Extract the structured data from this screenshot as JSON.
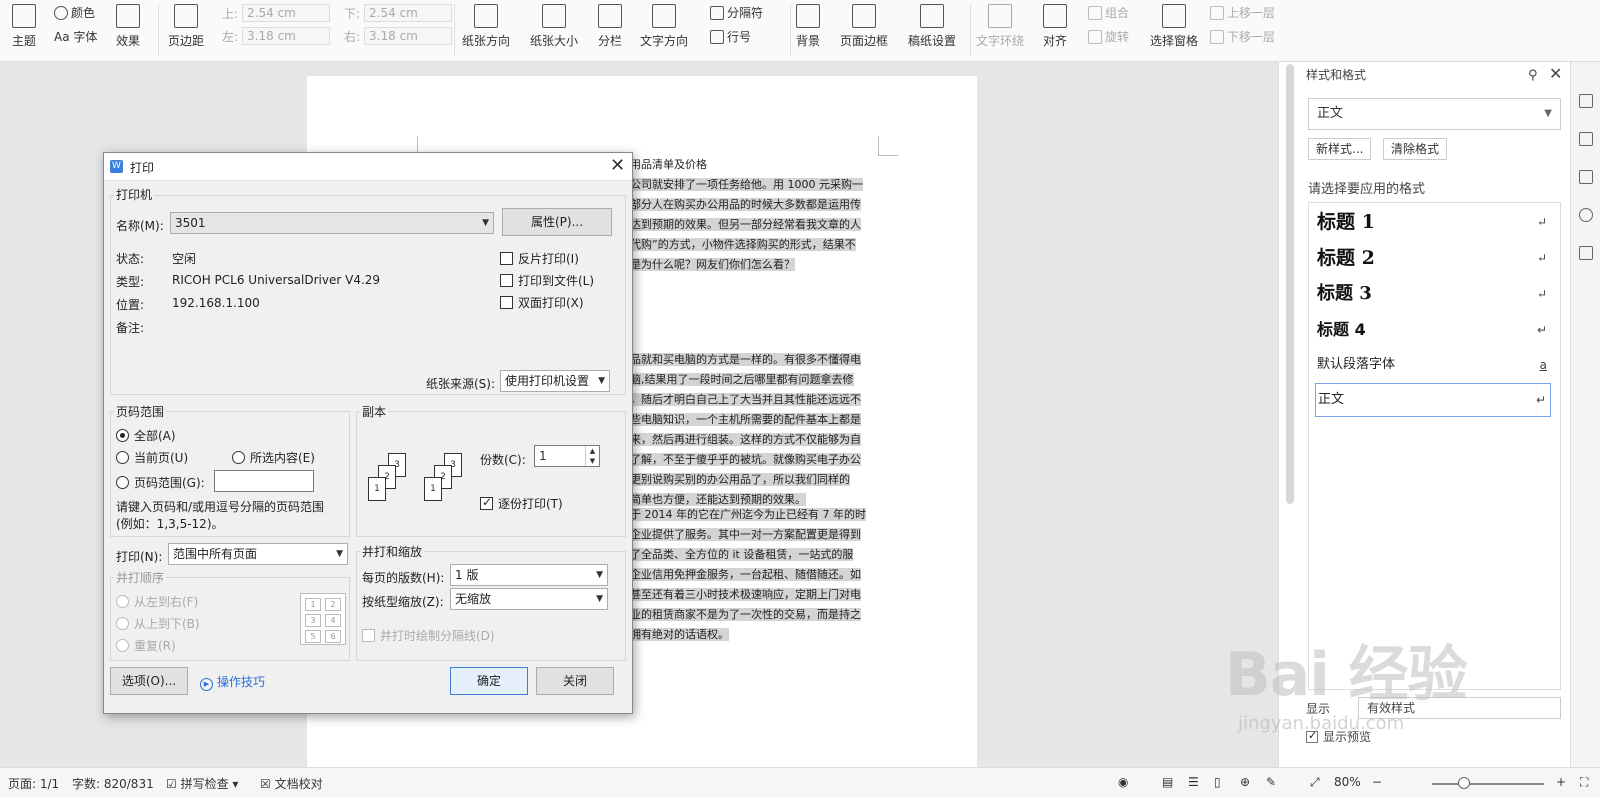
{
  "ribbon": {
    "theme": "主题",
    "color": "颜色",
    "font": "Aa 字体",
    "effect": "效果",
    "margin": "页边距",
    "margin_top_label": "上:",
    "margin_top": "2.54 cm",
    "margin_bottom_label": "下:",
    "margin_bottom": "2.54 cm",
    "margin_left_label": "左:",
    "margin_left": "3.18 cm",
    "margin_right_label": "右:",
    "margin_right": "3.18 cm",
    "orientation": "纸张方向",
    "size": "纸张大小",
    "columns": "分栏",
    "text_direction": "文字方向",
    "separator": "分隔符",
    "line_number": "行号",
    "background": "背景",
    "page_border": "页面边框",
    "manuscript": "稿纸设置",
    "text_wrap": "文字环绕",
    "align": "对齐",
    "group": "组合",
    "rotate": "旋转",
    "selection_pane": "选择窗格",
    "bring_forward": "上移一层",
    "send_backward": "下移一层"
  },
  "document": {
    "title": "用品清单及价格",
    "p1": [
      "公司就安排了一项任务给他。用 1000 元采购一",
      "部分人在购买办公用品的时候大多数都是运用传",
      "达到预期的效果。但另一部分经常看我文章的人",
      "代购”的方式，小物件选择购买的形式，结果不",
      "是为什么呢？网友们你们怎么看？"
    ],
    "p2": [
      "品就和买电脑的方式是一样的。有很多不懂得电",
      "脑,结果用了一段时间之后哪里都有问题拿去修",
      "，随后才明白自己上了大当并且其性能还远远不",
      "些电脑知识，一个主机所需要的配件基本上都是",
      "来，然后再进行组装。这样的方式不仅能够为自",
      "了解，不至于傻乎乎的被坑。就像购买电子办公",
      "更别说购买别的办公用品了，所以我们同样的",
      "简单也方便，还能达到预期的效果。"
    ],
    "p3": [
      "于 2014 年的它在广州迄今为止已经有 7 年的时",
      "企业提供了服务。其中一对一方案配置更是得到",
      "了全品类、全方位的 it 设备租赁，一站式的服",
      "企业信用免押金服务，一台起租、随借随还。如",
      "甚至还有着三小时技术极速响应，定期上门对电",
      "业的租赁商家不是为了一次性的交易，而是持之",
      "拥有绝对的话语权。"
    ]
  },
  "styles_panel": {
    "title": "样式和格式",
    "current_style": "正文",
    "new_style": "新样式...",
    "clear_format": "清除格式",
    "apply_label": "请选择要应用的格式",
    "items": [
      {
        "name": "标题 1"
      },
      {
        "name": "标题 2"
      },
      {
        "name": "标题 3"
      },
      {
        "name": "标题 4"
      },
      {
        "name": "默认段落字体"
      },
      {
        "name": "正文"
      }
    ],
    "return_mark": "↵",
    "char_mark": "a",
    "show_label": "显示",
    "show_value": "有效样式",
    "show_preview": "显示预览"
  },
  "watermark": {
    "logo": "Bai 经验",
    "url": "jingyan.baidu.com"
  },
  "status": {
    "page": "页面: 1/1",
    "words": "字数: 820/831",
    "spell": "拼写检查",
    "proof": "文档校对",
    "zoom": "80%"
  },
  "dialog": {
    "title": "打印",
    "printer_group": "打印机",
    "name_label": "名称(M):",
    "name_value": "3501",
    "properties": "属性(P)...",
    "status_label": "状态:",
    "status_value": "空闲",
    "type_label": "类型:",
    "type_value": "RICOH PCL6 UniversalDriver V4.29",
    "location_label": "位置:",
    "location_value": "192.168.1.100",
    "comment_label": "备注:",
    "reverse_print": "反片打印(I)",
    "print_to_file": "打印到文件(L)",
    "duplex": "双面打印(X)",
    "paper_source_label": "纸张来源(S):",
    "paper_source_value": "使用打印机设置",
    "range_group": "页码范围",
    "range_all": "全部(A)",
    "range_current": "当前页(U)",
    "range_selection": "所选内容(E)",
    "range_pages": "页码范围(G):",
    "range_hint1": "请键入页码和/或用逗号分隔的页码范围",
    "range_hint2": "(例如：1,3,5-12)。",
    "copies_group": "副本",
    "copies_label": "份数(C):",
    "copies_value": "1",
    "collate": "逐份打印(T)",
    "print_label": "打印(N):",
    "print_value": "范围中所有页面",
    "order_group": "并打顺序",
    "order_lr": "从左到右(F)",
    "order_tb": "从上到下(B)",
    "order_repeat": "重复(R)",
    "scale_group": "并打和缩放",
    "pages_per_sheet_label": "每页的版数(H):",
    "pages_per_sheet_value": "1 版",
    "scale_label": "按纸型缩放(Z):",
    "scale_value": "无缩放",
    "draw_lines": "并打时绘制分隔线(D)",
    "options": "选项(O)...",
    "tips": "操作技巧",
    "ok": "确定",
    "close": "关闭"
  }
}
